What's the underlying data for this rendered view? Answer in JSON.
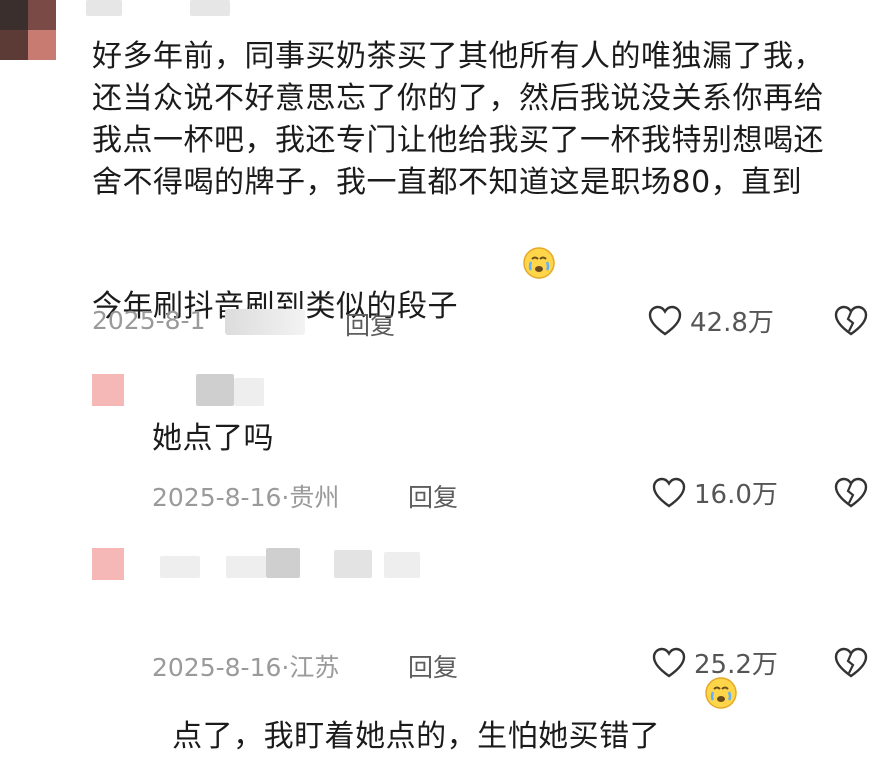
{
  "comments": [
    {
      "text_lines": [
        "好多年前，同事买奶茶买了其他所有人的唯独漏了我，",
        "还当众说不好意思忘了你的了，然后我说没关系你再给",
        "我点一杯吧，我还专门让他给我买了一杯我特别想喝还",
        "舍不得喝的牌子，我一直都不知道这是职场80，直到",
        "今年刷抖音刷到类似的段子"
      ],
      "emoji": "crying-face",
      "date": "2025-8-1",
      "reply_label": "回复",
      "likes": "42.8万"
    },
    {
      "text": "她点了吗",
      "date": "2025-8-16",
      "location": "贵州",
      "reply_label": "回复",
      "likes": "16.0万"
    },
    {
      "text": "点了，我盯着她点的，生怕她买错了",
      "emoji": "crying-face",
      "date": "2025-8-16",
      "location": "江苏",
      "reply_label": "回复",
      "likes": "25.2万"
    }
  ],
  "icons": {
    "like": "heart-outline-icon",
    "dislike": "broken-heart-icon"
  },
  "colors": {
    "text": "#1b1b1b",
    "meta": "#9a9a9a",
    "avatar_reply": "#f6b7b7"
  }
}
